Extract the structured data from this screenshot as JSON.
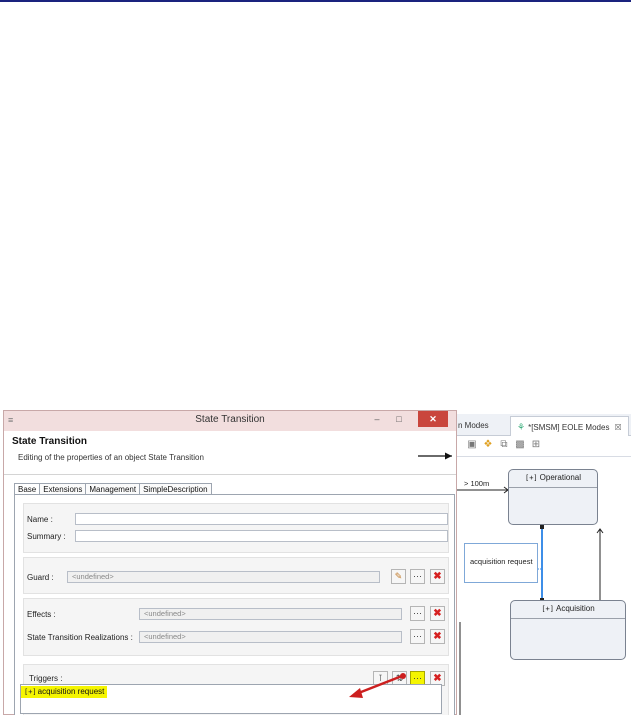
{
  "editor": {
    "tabs": [
      {
        "label": "n Modes"
      },
      {
        "label": "*[SMSM] EOLE Modes",
        "close": "☒"
      }
    ],
    "toolbar_icons": [
      "camera-icon",
      "tag-icon",
      "copy-icon",
      "fit-icon",
      "grid-icon"
    ],
    "diagram": {
      "states": [
        {
          "label": "Operational",
          "icon": "[+]"
        },
        {
          "label": "Acquisition",
          "icon": "[+]"
        }
      ],
      "note": "acquisition request",
      "edge_label": "> 100m"
    }
  },
  "dialog": {
    "window_title": "State Transition",
    "header_title": "State Transition",
    "header_subtitle": "Editing of the properties of an object State Transition",
    "tabs": [
      "Base",
      "Extensions",
      "Management",
      "SimpleDescription"
    ],
    "fields": {
      "name_label": "Name :",
      "name_value": "",
      "summary_label": "Summary :",
      "summary_value": "",
      "guard_label": "Guard :",
      "guard_value": "<undefined>",
      "effects_label": "Effects :",
      "effects_value": "<undefined>",
      "realizations_label": "State Transition Realizations :",
      "realizations_value": "<undefined>",
      "triggers_label": "Triggers :"
    },
    "triggers": [
      {
        "label": "acquisition request",
        "icon": "[+]"
      }
    ],
    "colors": {
      "highlight": "#f5f500",
      "annotation_arrow": "#cc1f1f",
      "selected_edge": "#3d8ee8"
    }
  }
}
